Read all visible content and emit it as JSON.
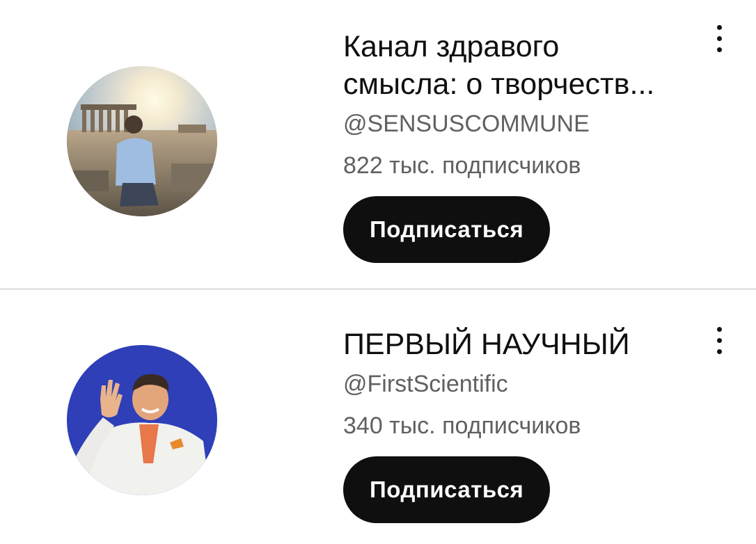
{
  "channels": [
    {
      "title_line1": "Канал здравого",
      "title_line2": "смысла: о творчеств...",
      "handle": "@SENSUSCOMMUNE",
      "subscribers": "822 тыс. подписчиков",
      "subscribe_label": "Подписаться",
      "menu_icon": "more-vertical-icon"
    },
    {
      "title_line1": "ПЕРВЫЙ НАУЧНЫЙ",
      "handle": "@FirstScientific",
      "subscribers": "340 тыс. подписчиков",
      "subscribe_label": "Подписаться",
      "menu_icon": "more-vertical-icon"
    }
  ],
  "colors": {
    "button_bg": "#0f0f0f",
    "button_text": "#ffffff",
    "secondary_text": "#606060",
    "divider": "#e5e5e5"
  }
}
